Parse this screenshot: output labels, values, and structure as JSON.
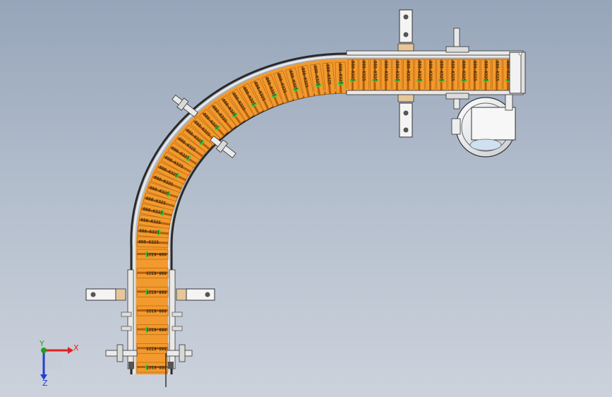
{
  "viewport": {
    "name": "3D CAD model view",
    "background_top": "#97a5ba",
    "background_bottom": "#ccd2dc"
  },
  "conveyor": {
    "chain_color": "#f29a2e",
    "chain_dark": "#c26d12",
    "frame_color": "#e9e9e9",
    "guide_color": "#2a2a2a",
    "wear_strip_color": "#3ecf3e",
    "link_label": "880-K325",
    "link_count_straight": 15,
    "link_count_curve": 26,
    "link_count_vertical": 7
  },
  "triad": {
    "x_label": "X",
    "y_label": "Y",
    "z_label": "Z",
    "x_color": "#e02020",
    "y_color": "#20a020",
    "z_color": "#2040d0"
  }
}
